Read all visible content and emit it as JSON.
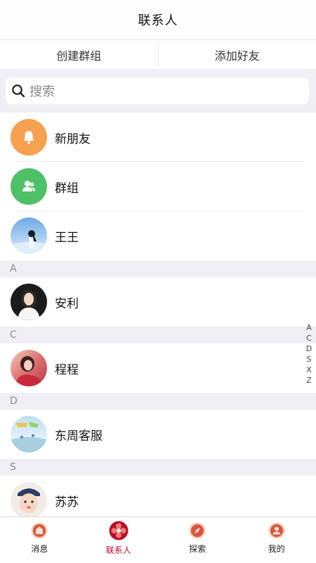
{
  "header": {
    "title": "联系人"
  },
  "actions": {
    "create_group": "创建群组",
    "add_friend": "添加好友"
  },
  "search": {
    "placeholder": "搜索"
  },
  "fixed_items": [
    {
      "label": "新朋友",
      "icon": "bell-icon",
      "color": "#f7a04f"
    },
    {
      "label": "群组",
      "icon": "group-icon",
      "color": "#4ec067"
    },
    {
      "label": "王王"
    }
  ],
  "sections": [
    {
      "letter": "A",
      "contacts": [
        "安利"
      ]
    },
    {
      "letter": "C",
      "contacts": [
        "程程"
      ]
    },
    {
      "letter": "D",
      "contacts": [
        "东周客服"
      ]
    },
    {
      "letter": "S",
      "contacts": [
        "苏苏"
      ]
    }
  ],
  "index_letters": [
    "A",
    "C",
    "D",
    "S",
    "X",
    "Z"
  ],
  "tabbar": {
    "tabs": [
      {
        "label": "消息",
        "icon": "message-icon"
      },
      {
        "label": "联系人",
        "icon": "contacts-icon",
        "active": true
      },
      {
        "label": "探索",
        "icon": "explore-icon"
      },
      {
        "label": "我的",
        "icon": "profile-icon"
      }
    ],
    "accent": "#b3112b"
  }
}
